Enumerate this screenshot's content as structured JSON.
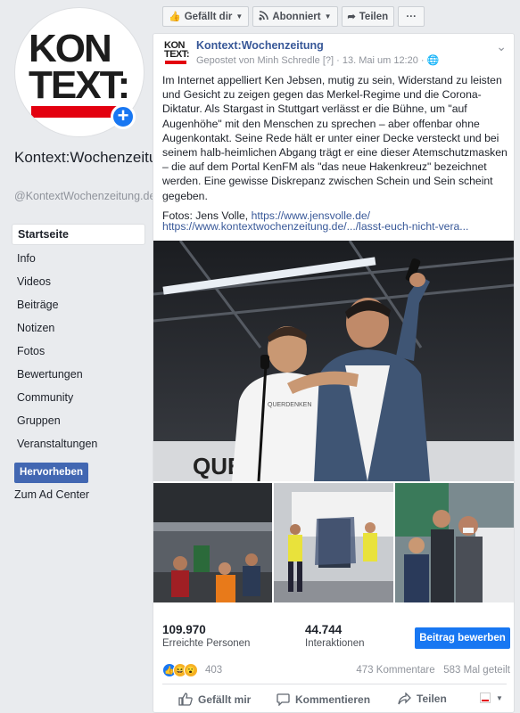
{
  "sidebar": {
    "logo_line1": "KON",
    "logo_line2": "TEXT:",
    "page_name": "Kontext:Wochenzeitung",
    "handle": "@KontextWochenzeitung.de",
    "nav": [
      {
        "label": "Startseite",
        "active": true
      },
      {
        "label": "Info"
      },
      {
        "label": "Videos"
      },
      {
        "label": "Beiträge"
      },
      {
        "label": "Notizen"
      },
      {
        "label": "Fotos"
      },
      {
        "label": "Bewertungen"
      },
      {
        "label": "Community"
      },
      {
        "label": "Gruppen"
      },
      {
        "label": "Veranstaltungen"
      }
    ],
    "promote_label": "Hervorheben",
    "ad_center_label": "Zum Ad Center"
  },
  "toolbar": {
    "like_label": "Gefällt dir",
    "follow_label": "Abonniert",
    "share_label": "Teilen",
    "more_label": "···"
  },
  "post": {
    "author": "Kontext:Wochenzeitung",
    "meta": "Gepostet von Minh Schredle [?] · 13. Mai um 12:20 ·",
    "menu": "⌄",
    "paragraph1": "Im Internet appelliert Ken Jebsen, mutig zu sein, Widerstand zu leisten und Gesicht zu zeigen gegen das Merkel-Regime und die Corona-Diktatur. Als Stargast in Stuttgart verlässt er die Bühne, um \"auf Augenhöhe\" mit den Menschen zu sprechen – aber offenbar ohne Augenkontakt. Seine Rede hält er unter einer Decke versteckt und bei seinem halb-heimlichen Abgang trägt er eine dieser Atemschutzmasken – die auf dem Portal KenFM als \"das neue Hakenkreuz\" bezeichnet werden. Eine gewisse Diskrepanz zwischen Schein und Sein scheint gegeben.",
    "photo_credit_prefix": "Fotos: Jens Volle, ",
    "photo_credit_link": "https://www.jensvolle.de/",
    "article_link": "https://www.kontextwochenzeitung.de/.../lasst-euch-nicht-vera...",
    "shirt_text": "QUERDENKEN",
    "sign_text": "QUE"
  },
  "insights": {
    "reach_value": "109.970",
    "reach_label": "Erreichte Personen",
    "engagement_value": "44.744",
    "engagement_label": "Interaktionen",
    "boost_label": "Beitrag bewerben"
  },
  "reactions": {
    "count": "403",
    "comments": "473 Kommentare",
    "shares": "583 Mal geteilt"
  },
  "actions": {
    "like": "Gefällt mir",
    "comment": "Kommentieren",
    "share": "Teilen"
  },
  "colors": {
    "accent": "#4267b2",
    "link": "#385898",
    "brand_red": "#e3000f",
    "boost": "#1877f2"
  }
}
